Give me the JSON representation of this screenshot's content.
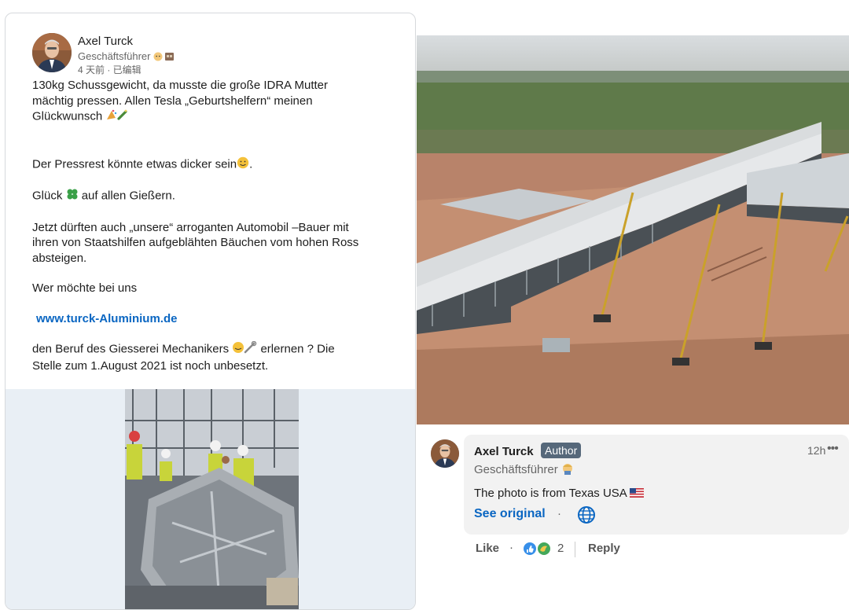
{
  "post": {
    "author_name": "Axel Turck",
    "author_role": "Geschäftsführer",
    "meta": "4 天前 · 已编辑",
    "line1": "130kg Schussgewicht, da musste die große IDRA Mutter",
    "line2": "mächtig pressen. Allen Tesla „Geburtshelfern“ meinen",
    "line3": "Glückwunsch",
    "line4": "Der Pressrest könnte etwas dicker sein",
    "line5a": "Glück",
    "line5b": "auf allen Gießern.",
    "line6": "Jetzt dürften auch „unsere“ arroganten Automobil –Bauer mit",
    "line7": "ihren von Staatshilfen aufgeblähten Bäuchen vom hohen Ross",
    "line8": "absteigen.",
    "line9": "Wer möchte bei uns",
    "link": "www.turck-Aluminium.de",
    "line10a": "den Beruf des Giesserei Mechanikers",
    "line10b": "erlernen ? Die",
    "line11": "Stelle zum 1.August 2021 ist noch unbesetzt."
  },
  "comment": {
    "author_name": "Axel Turck",
    "badge": "Author",
    "time": "12h",
    "more": "•••",
    "role": "Geschäftsführer",
    "text": "The photo is from Texas USA",
    "see_original": "See original",
    "dot": "·"
  },
  "actions": {
    "like": "Like",
    "dot": "·",
    "reaction_count": "2",
    "reply": "Reply"
  },
  "icons": {
    "globe": "globe-icon",
    "flag": "us-flag-icon",
    "clover": "four-leaf-clover-icon"
  },
  "colors": {
    "link": "#0a66c2",
    "badge": "#56687a",
    "bubble": "#f2f2f2"
  }
}
